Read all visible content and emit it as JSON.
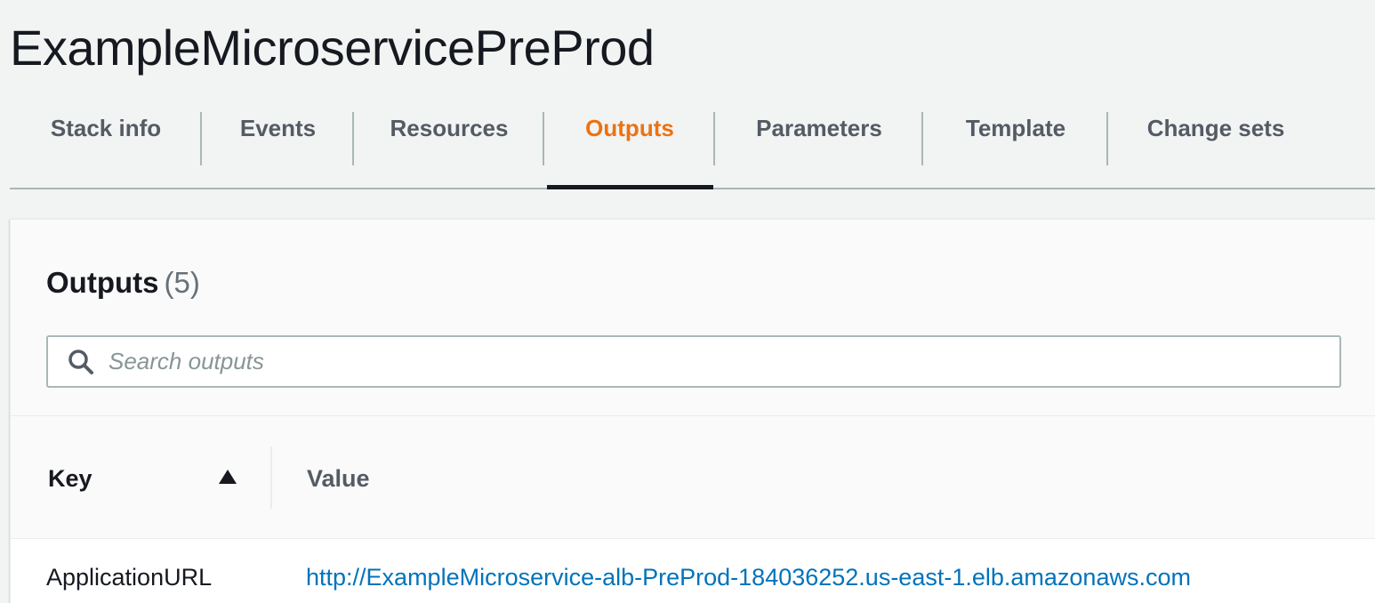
{
  "stack": {
    "title": "ExampleMicroservicePreProd"
  },
  "tabs": [
    {
      "label": "Stack info",
      "active": false
    },
    {
      "label": "Events",
      "active": false
    },
    {
      "label": "Resources",
      "active": false
    },
    {
      "label": "Outputs",
      "active": true
    },
    {
      "label": "Parameters",
      "active": false
    },
    {
      "label": "Template",
      "active": false
    },
    {
      "label": "Change sets",
      "active": false
    }
  ],
  "outputs": {
    "heading": "Outputs",
    "count": "(5)",
    "search": {
      "placeholder": "Search outputs",
      "value": ""
    },
    "columns": {
      "key": "Key",
      "value": "Value"
    },
    "rows": [
      {
        "key": "ApplicationURL",
        "value": "http://ExampleMicroservice-alb-PreProd-184036252.us-east-1.elb.amazonaws.com"
      }
    ]
  },
  "colors": {
    "active_tab": "#ec7211",
    "link": "#0073bb"
  }
}
